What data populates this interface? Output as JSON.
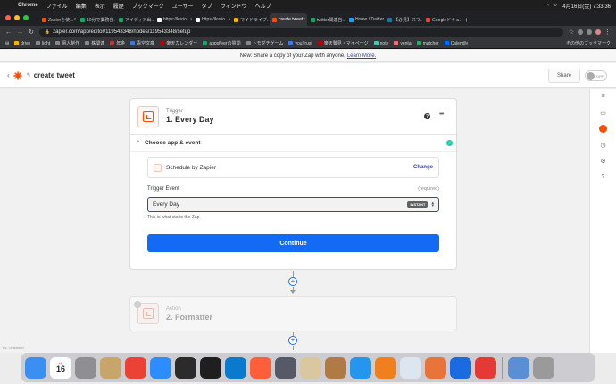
{
  "menubar": {
    "app": "Chrome",
    "items": [
      "ファイル",
      "編集",
      "表示",
      "履歴",
      "ブックマーク",
      "ユーザー",
      "タブ",
      "ウィンドウ",
      "ヘルプ"
    ],
    "clock": "4月16日(金)  7:33:36"
  },
  "tabs": [
    {
      "label": "Zapierを使...",
      "color": "#ff4a00"
    },
    {
      "label": "10分で業務自...",
      "color": "#1aa260"
    },
    {
      "label": "アイディア出...",
      "color": "#1aa260"
    },
    {
      "label": "https://kurio...",
      "color": "#ffffff"
    },
    {
      "label": "https://kurio...",
      "color": "#ffffff"
    },
    {
      "label": "マイドライブ...",
      "color": "#f4b400"
    },
    {
      "label": "create tweet",
      "color": "#ff4a00"
    },
    {
      "label": "twitter関連自...",
      "color": "#1aa260"
    },
    {
      "label": "Home / Twitter",
      "color": "#1da1f2"
    },
    {
      "label": "【必見】スマ...",
      "color": "#21759b"
    },
    {
      "label": "Googleドキュ...",
      "color": "#ea4335"
    }
  ],
  "url": "zapier.com/app/editor/119543348/nodes/119543348/setup",
  "bookmarks": [
    {
      "label": "drive",
      "color": "#f4b400"
    },
    {
      "label": "light",
      "color": "#888888"
    },
    {
      "label": "個人制作",
      "color": "#888888"
    },
    {
      "label": "株関連",
      "color": "#888888"
    },
    {
      "label": "年金",
      "color": "#c0392b"
    },
    {
      "label": "青空文庫",
      "color": "#3a7bd5"
    },
    {
      "label": "楽天カレンダー",
      "color": "#bf0000"
    },
    {
      "label": "appsflyerの質問",
      "color": "#1aa260"
    },
    {
      "label": "トモダチゲーム",
      "color": "#888888"
    },
    {
      "label": "youTrust",
      "color": "#2f80ed"
    },
    {
      "label": "楽天鷲見・マイページ",
      "color": "#bf0000"
    },
    {
      "label": "note",
      "color": "#41c9b4"
    },
    {
      "label": "yenta",
      "color": "#ff6b6b"
    },
    {
      "label": "matcher",
      "color": "#27ae60"
    },
    {
      "label": "Calendly",
      "color": "#006bff"
    }
  ],
  "other_bookmarks": "その他のブックマーク",
  "banner": {
    "text": "New: Share a copy of your Zap with anyone.",
    "link": "Learn More."
  },
  "zap": {
    "title": "create tweet",
    "share": "Share",
    "toggle": "OFF"
  },
  "trigger": {
    "kind": "Trigger",
    "step": "1. Every Day",
    "section": "Choose app & event",
    "app_name": "Schedule by Zapier",
    "change": "Change",
    "field_label": "Trigger Event",
    "required": "(required)",
    "field_value": "Every Day",
    "badge": "INSTANT",
    "hint": "This is what starts the Zap.",
    "continue": "Continue"
  },
  "action": {
    "kind": "Action",
    "step": "2. Formatter"
  },
  "status_text": "us...deadfit.cl",
  "dock": [
    {
      "name": "finder",
      "color": "#3b8ff0"
    },
    {
      "name": "calendar",
      "label": "16"
    },
    {
      "name": "system-preferences",
      "color": "#8e8e93"
    },
    {
      "name": "contacts",
      "color": "#c8a56a"
    },
    {
      "name": "chrome",
      "color": "#ea4335"
    },
    {
      "name": "zoom",
      "color": "#2d8cff"
    },
    {
      "name": "activity-monitor",
      "color": "#2b2b2b"
    },
    {
      "name": "terminal",
      "color": "#1f1f1f"
    },
    {
      "name": "vscode",
      "color": "#0a7acc"
    },
    {
      "name": "safari",
      "color": "#ff5e3a"
    },
    {
      "name": "quicktime",
      "color": "#555a66"
    },
    {
      "name": "sequel-pro",
      "color": "#d9c7a0"
    },
    {
      "name": "the-unarchiver",
      "color": "#b07a45"
    },
    {
      "name": "docker",
      "color": "#2496ed"
    },
    {
      "name": "sourcetree",
      "color": "#f07f1e"
    },
    {
      "name": "postman",
      "color": "#dde6f0"
    },
    {
      "name": "preview",
      "color": "#e9743a"
    },
    {
      "name": "infinity",
      "color": "#1a6be0"
    },
    {
      "name": "todo",
      "color": "#e53935"
    },
    {
      "name": "photos",
      "color": "#5a8fd6"
    },
    {
      "name": "trash",
      "color": "#9a9a9a"
    }
  ]
}
